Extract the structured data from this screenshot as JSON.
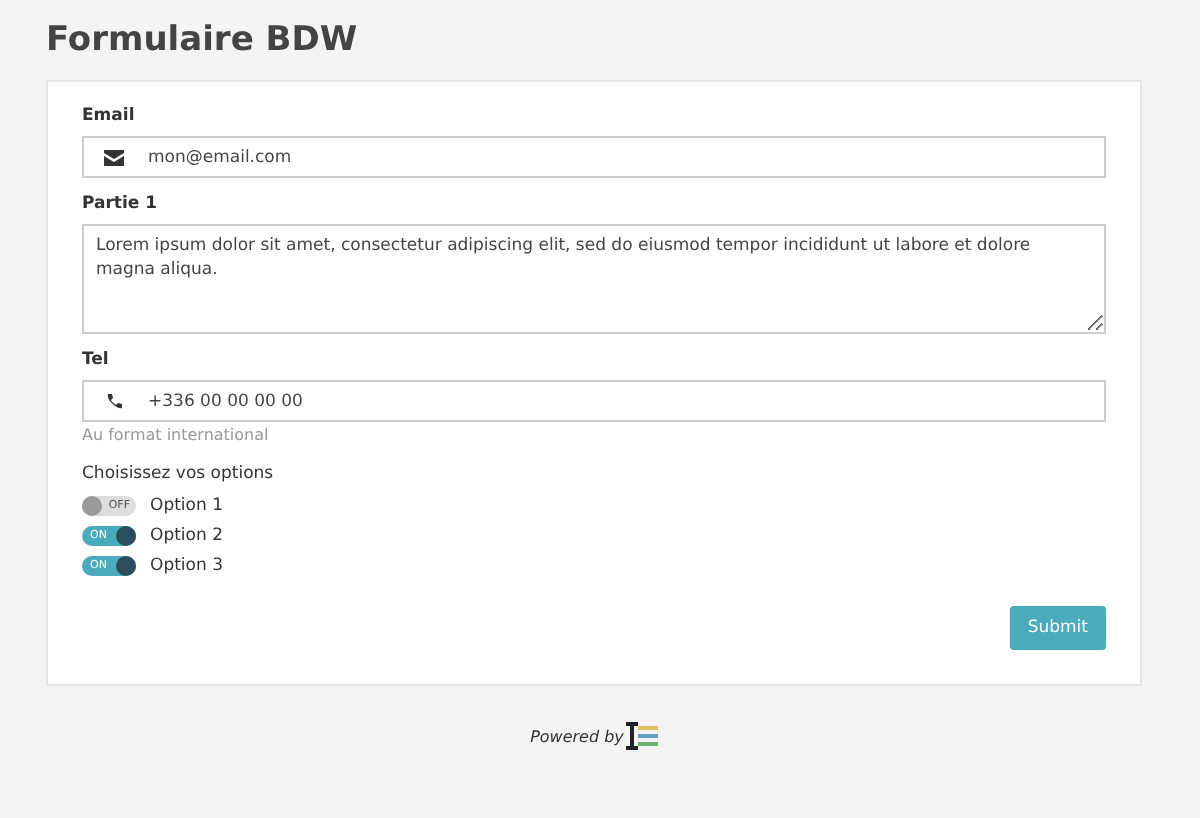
{
  "title": "Formulaire BDW",
  "email": {
    "label": "Email",
    "value": "mon@email.com"
  },
  "partie": {
    "label": "Partie 1",
    "value": "Lorem ipsum dolor sit amet, consectetur adipiscing elit, sed do eiusmod tempor incididunt ut labore et dolore magna aliqua."
  },
  "tel": {
    "label": "Tel",
    "value": "+336 00 00 00 00",
    "help": "Au format international"
  },
  "options": {
    "label": "Choisissez vos options",
    "items": [
      {
        "label": "Option 1",
        "on": false,
        "toggle_text": "OFF"
      },
      {
        "label": "Option 2",
        "on": true,
        "toggle_text": "ON"
      },
      {
        "label": "Option 3",
        "on": true,
        "toggle_text": "ON"
      }
    ]
  },
  "submit": "Submit",
  "footer": "Powered by"
}
